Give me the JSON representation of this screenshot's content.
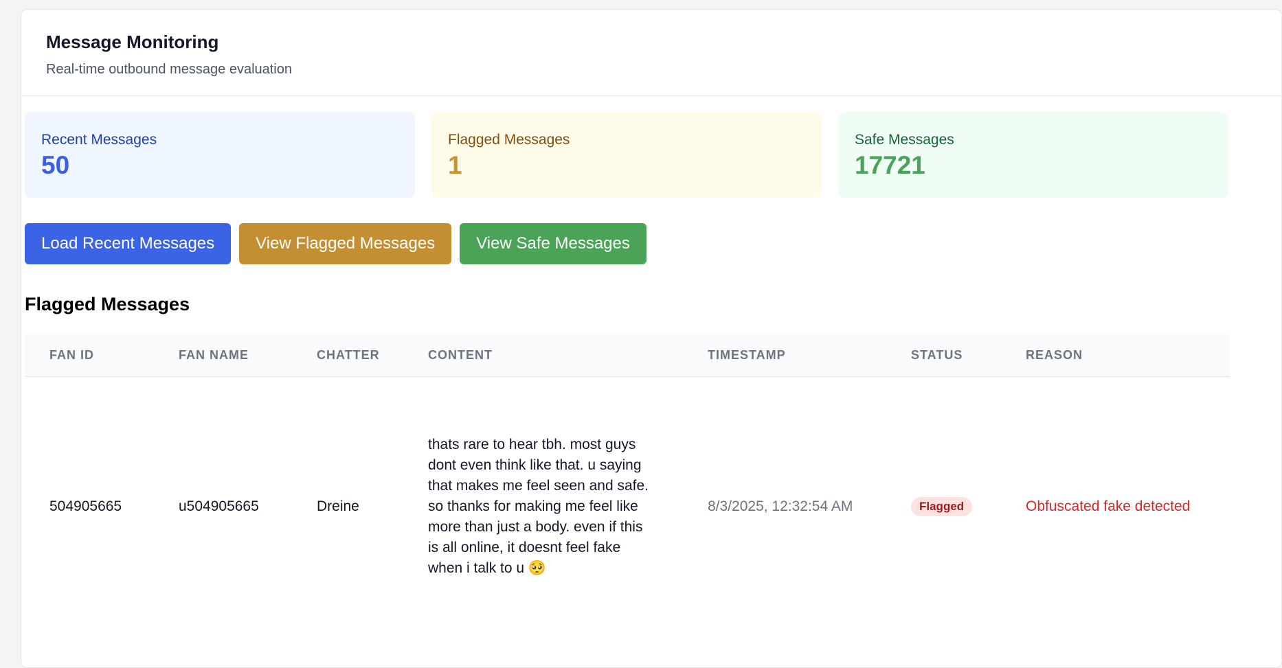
{
  "header": {
    "title": "Message Monitoring",
    "subtitle": "Real-time outbound message evaluation"
  },
  "stats": [
    {
      "label": "Recent Messages",
      "value": "50",
      "bg": "#eff6ff",
      "label_color": "#1e40af",
      "value_color": "#3b5fe0"
    },
    {
      "label": "Flagged Messages",
      "value": "1",
      "bg": "#fefce8",
      "label_color": "#854d0e",
      "value_color": "#c9922e"
    },
    {
      "label": "Safe Messages",
      "value": "17721",
      "bg": "#f0fdf4",
      "label_color": "#166534",
      "value_color": "#4aa356"
    }
  ],
  "actions": {
    "load_recent": {
      "label": "Load Recent Messages",
      "color": "#3b63e6"
    },
    "view_flagged": {
      "label": "View Flagged Messages",
      "color": "#c48e32"
    },
    "view_safe": {
      "label": "View Safe Messages",
      "color": "#4aa356"
    }
  },
  "section": {
    "title": "Flagged Messages"
  },
  "table": {
    "columns": [
      "FAN ID",
      "FAN NAME",
      "CHATTER",
      "CONTENT",
      "TIMESTAMP",
      "STATUS",
      "REASON"
    ],
    "rows": [
      {
        "fan_id": "504905665",
        "fan_name": "u504905665",
        "chatter": "Dreine",
        "content": "thats rare to hear tbh. most guys dont even think like that. u saying that makes me feel seen and safe. so thanks for making me feel like more than just a body. even if this is all online, it doesnt feel fake when i talk to u 🥺",
        "timestamp": "8/3/2025, 12:32:54 AM",
        "status": "Flagged",
        "reason": "Obfuscated fake detected"
      }
    ]
  }
}
